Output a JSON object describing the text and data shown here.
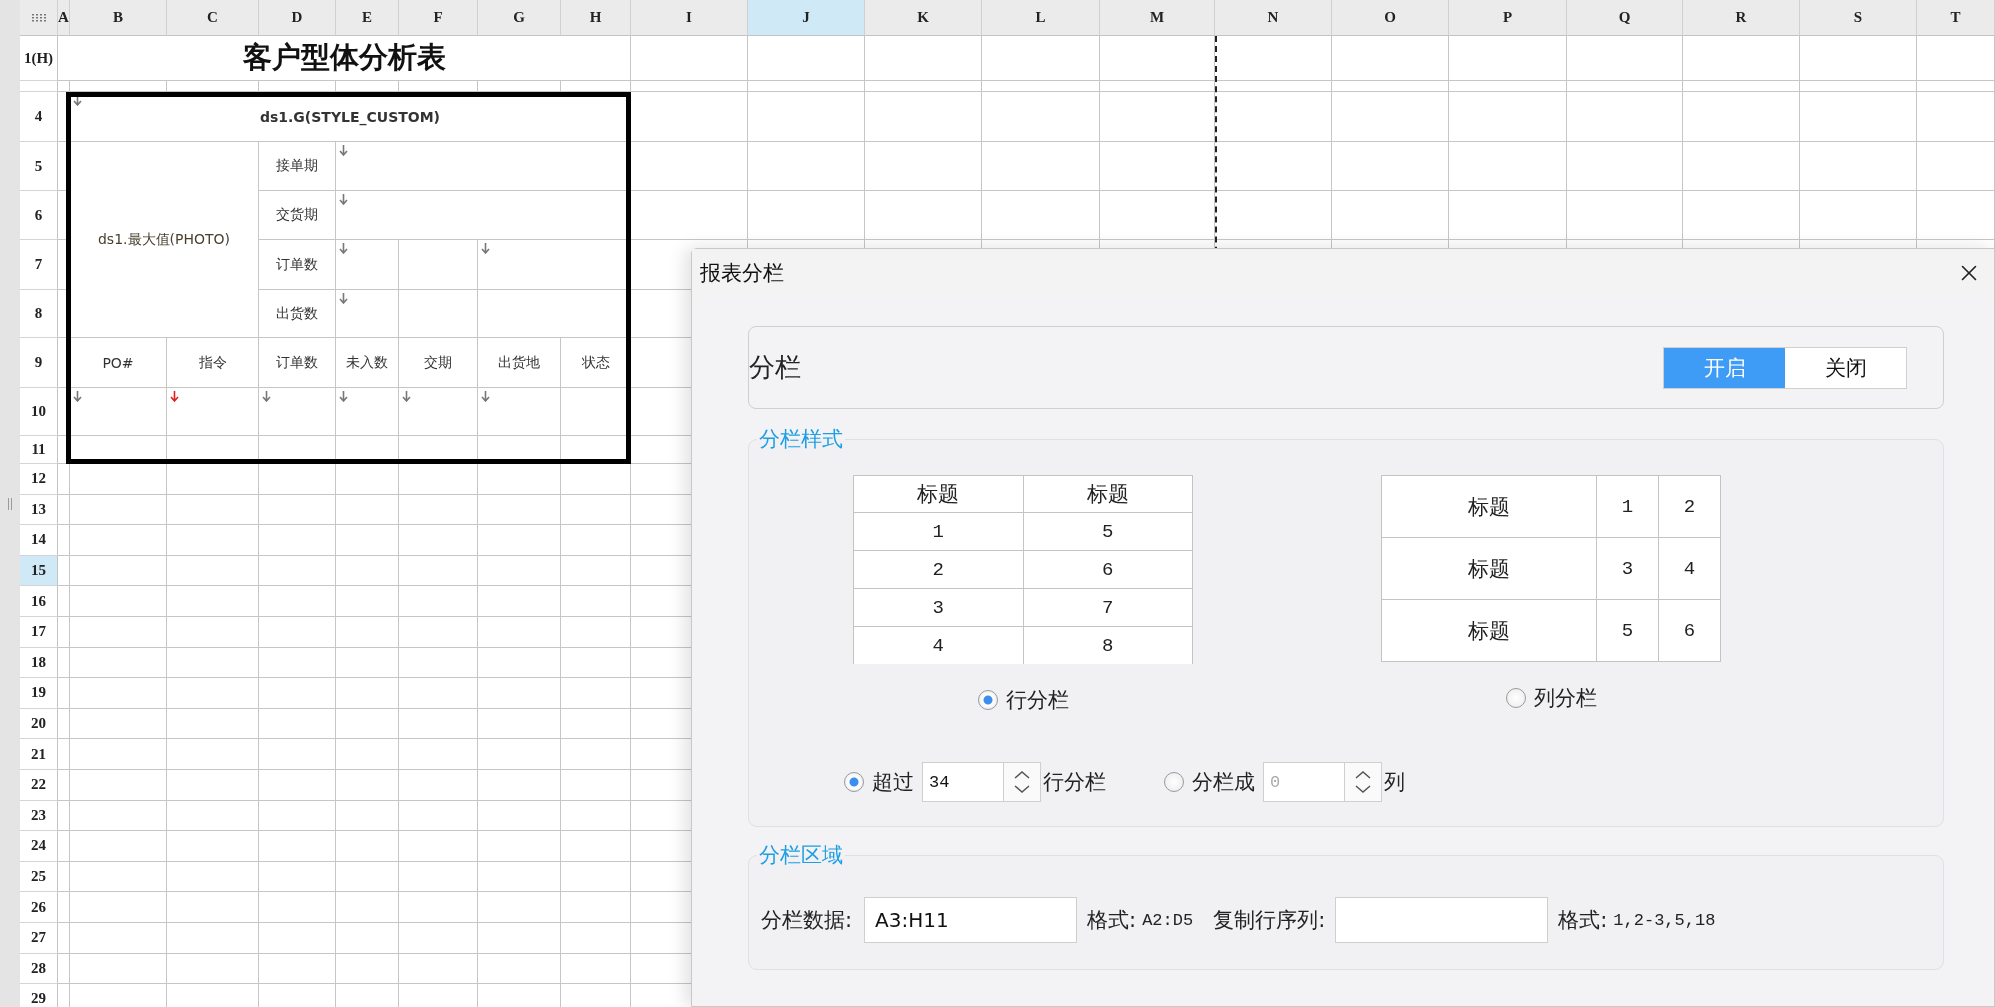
{
  "sheet": {
    "columns": [
      {
        "label": "A",
        "selected": false
      },
      {
        "label": "B",
        "selected": false
      },
      {
        "label": "C",
        "selected": false
      },
      {
        "label": "D",
        "selected": false
      },
      {
        "label": "E",
        "selected": false
      },
      {
        "label": "F",
        "selected": false
      },
      {
        "label": "G",
        "selected": false
      },
      {
        "label": "H",
        "selected": false
      },
      {
        "label": "I",
        "selected": false
      },
      {
        "label": "J",
        "selected": true
      },
      {
        "label": "K",
        "selected": false
      },
      {
        "label": "L",
        "selected": false
      },
      {
        "label": "M",
        "selected": false
      },
      {
        "label": "N",
        "selected": false
      },
      {
        "label": "O",
        "selected": false
      },
      {
        "label": "P",
        "selected": false
      },
      {
        "label": "Q",
        "selected": false
      },
      {
        "label": "R",
        "selected": false
      },
      {
        "label": "S",
        "selected": false
      },
      {
        "label": "T",
        "selected": false
      }
    ],
    "rows": [
      {
        "label": "1(H)",
        "selected": false
      },
      {
        "label": "4",
        "selected": false
      },
      {
        "label": "5",
        "selected": false
      },
      {
        "label": "6",
        "selected": false
      },
      {
        "label": "7",
        "selected": false
      },
      {
        "label": "8",
        "selected": false
      },
      {
        "label": "9",
        "selected": false
      },
      {
        "label": "10",
        "selected": false
      },
      {
        "label": "11",
        "selected": false
      },
      {
        "label": "12",
        "selected": false
      },
      {
        "label": "13",
        "selected": false
      },
      {
        "label": "14",
        "selected": false
      },
      {
        "label": "15",
        "selected": true
      },
      {
        "label": "16",
        "selected": false
      },
      {
        "label": "17",
        "selected": false
      },
      {
        "label": "18",
        "selected": false
      },
      {
        "label": "19",
        "selected": false
      },
      {
        "label": "20",
        "selected": false
      },
      {
        "label": "21",
        "selected": false
      },
      {
        "label": "22",
        "selected": false
      },
      {
        "label": "23",
        "selected": false
      },
      {
        "label": "24",
        "selected": false
      },
      {
        "label": "25",
        "selected": false
      },
      {
        "label": "26",
        "selected": false
      },
      {
        "label": "27",
        "selected": false
      },
      {
        "label": "28",
        "selected": false
      },
      {
        "label": "29",
        "selected": false
      }
    ],
    "report": {
      "title": "客户型体分析表",
      "group_field": "ds1.G(STYLE_CUSTOM)",
      "photo_field": "ds1.最大值(PHOTO)",
      "info_labels": [
        "接单期",
        "交货期",
        "订单数",
        "出货数"
      ],
      "headers": [
        "PO#",
        "指令",
        "订单数",
        "未入数",
        "交期",
        "出货地",
        "状态"
      ]
    }
  },
  "dialog": {
    "title": "报表分栏",
    "enable": {
      "label": "分栏",
      "options": [
        {
          "label": "开启",
          "selected": true
        },
        {
          "label": "关闭",
          "selected": false
        }
      ]
    },
    "style_section": {
      "legend": "分栏样式",
      "row_preview": {
        "header": [
          "标题",
          "标题"
        ],
        "rows": [
          [
            "1",
            "5"
          ],
          [
            "2",
            "6"
          ],
          [
            "3",
            "7"
          ],
          [
            "4",
            "8"
          ]
        ]
      },
      "column_preview": {
        "rows": [
          [
            "标题",
            "1",
            "2"
          ],
          [
            "标题",
            "3",
            "4"
          ],
          [
            "标题",
            "5",
            "6"
          ]
        ]
      },
      "layout_options": [
        {
          "label": "行分栏",
          "selected": true
        },
        {
          "label": "列分栏",
          "selected": false
        }
      ],
      "split_options": [
        {
          "prefix": "超过",
          "value": "34",
          "suffix": "行分栏",
          "selected": true,
          "disabled": false
        },
        {
          "prefix": "分栏成",
          "value": "0",
          "suffix": "列",
          "selected": false,
          "disabled": true
        }
      ]
    },
    "area_section": {
      "legend": "分栏区域",
      "data_label": "分栏数据:",
      "data_value": "A3:H11",
      "data_hint_label": "格式:",
      "data_hint": "A2:D5",
      "repeat_label": "复制行序列:",
      "repeat_hint_label": "格式:",
      "repeat_hint": "1,2-3,5,18"
    }
  }
}
